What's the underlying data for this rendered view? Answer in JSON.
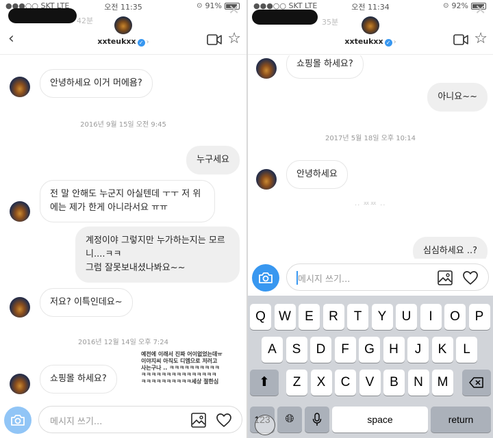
{
  "left": {
    "status": {
      "carrier": "●●●○○ SKT  LTE",
      "time": "오전 11:35",
      "battery": "91%",
      "battery_level": 0.91
    },
    "header": {
      "faded_time": "42분",
      "username": "xxteukxx"
    },
    "messages": [
      {
        "kind": "in",
        "text": "안녕하세요 이거 머에욤?"
      },
      {
        "kind": "time",
        "text": "2016년 9월 15일 오전 9:45"
      },
      {
        "kind": "out",
        "text": "누구세요"
      },
      {
        "kind": "in",
        "line1": "전 말 안해도 누군지 아실텐데 ㅜㅜ 저 위",
        "line2": "에는 제가 한게 아니라서요 ㅠㅠ"
      },
      {
        "kind": "out",
        "line1": "계정이야 그렇지만 누가하는지는 모르",
        "line2": "니....ㅋㅋ",
        "line3": "그럼 잘못보내셨나봐요~~"
      },
      {
        "kind": "in",
        "text": "저요? 이특인데요~"
      },
      {
        "kind": "time",
        "text": "2016년 12월 14일 오후 7:24"
      },
      {
        "kind": "in",
        "text": "쇼핑몰 하세요?"
      }
    ],
    "note": {
      "line1": "예전에 이래서 진짜 어이없었는데ㅠ",
      "line2": "이야지씨 아직도 디엠으로 저러고",
      "line3": "사는구나 ..  ㅋㅋㅋㅋㅋㅋㅋㅋㅋㅋ",
      "line4": "ㅋㅋㅋㅋㅋㅋㅋㅋㅋㅋㅋㅋㅋㅋㅋ",
      "line5": "ㅋㅋㅋㅋㅋㅋㅋㅋㅋㅋ세상 절한심"
    },
    "composer": {
      "placeholder": "메시지 쓰기..."
    }
  },
  "right": {
    "status": {
      "carrier": "●●●○○ SKT  LTE",
      "time": "오전 11:34",
      "battery": "92%",
      "battery_level": 0.92
    },
    "header": {
      "faded_time": "35분",
      "username": "xxteukxx"
    },
    "messages": [
      {
        "kind": "in",
        "text": "쇼핑몰 하세요?"
      },
      {
        "kind": "out",
        "text": "아니요~~"
      },
      {
        "kind": "time",
        "text": "2017년 5월 18일 오후 10:14"
      },
      {
        "kind": "in",
        "text": "안녕하세요"
      },
      {
        "kind": "out",
        "text": "심심하세요 ..?"
      }
    ],
    "faded_dots": "·· ᄍᄍ ··",
    "composer": {
      "placeholder": "메시지 쓰기..."
    },
    "keyboard": {
      "row1": [
        "Q",
        "W",
        "E",
        "R",
        "T",
        "Y",
        "U",
        "I",
        "O",
        "P"
      ],
      "row2": [
        "A",
        "S",
        "D",
        "F",
        "G",
        "H",
        "J",
        "K",
        "L"
      ],
      "row3": [
        "Z",
        "X",
        "C",
        "V",
        "B",
        "N",
        "M"
      ],
      "numbers_label": "123",
      "space_label": "space",
      "return_label": "return",
      "shift_icon": "shift-arrow",
      "delete_icon": "backspace",
      "globe_icon": "globe",
      "mic_icon": "microphone",
      "emoji_icon": "smiley"
    }
  },
  "colors": {
    "accent": "#3897f0",
    "bubble_out": "#efefef",
    "keyboard_bg": "#d1d4d9",
    "dark_key": "#abb1ba"
  }
}
